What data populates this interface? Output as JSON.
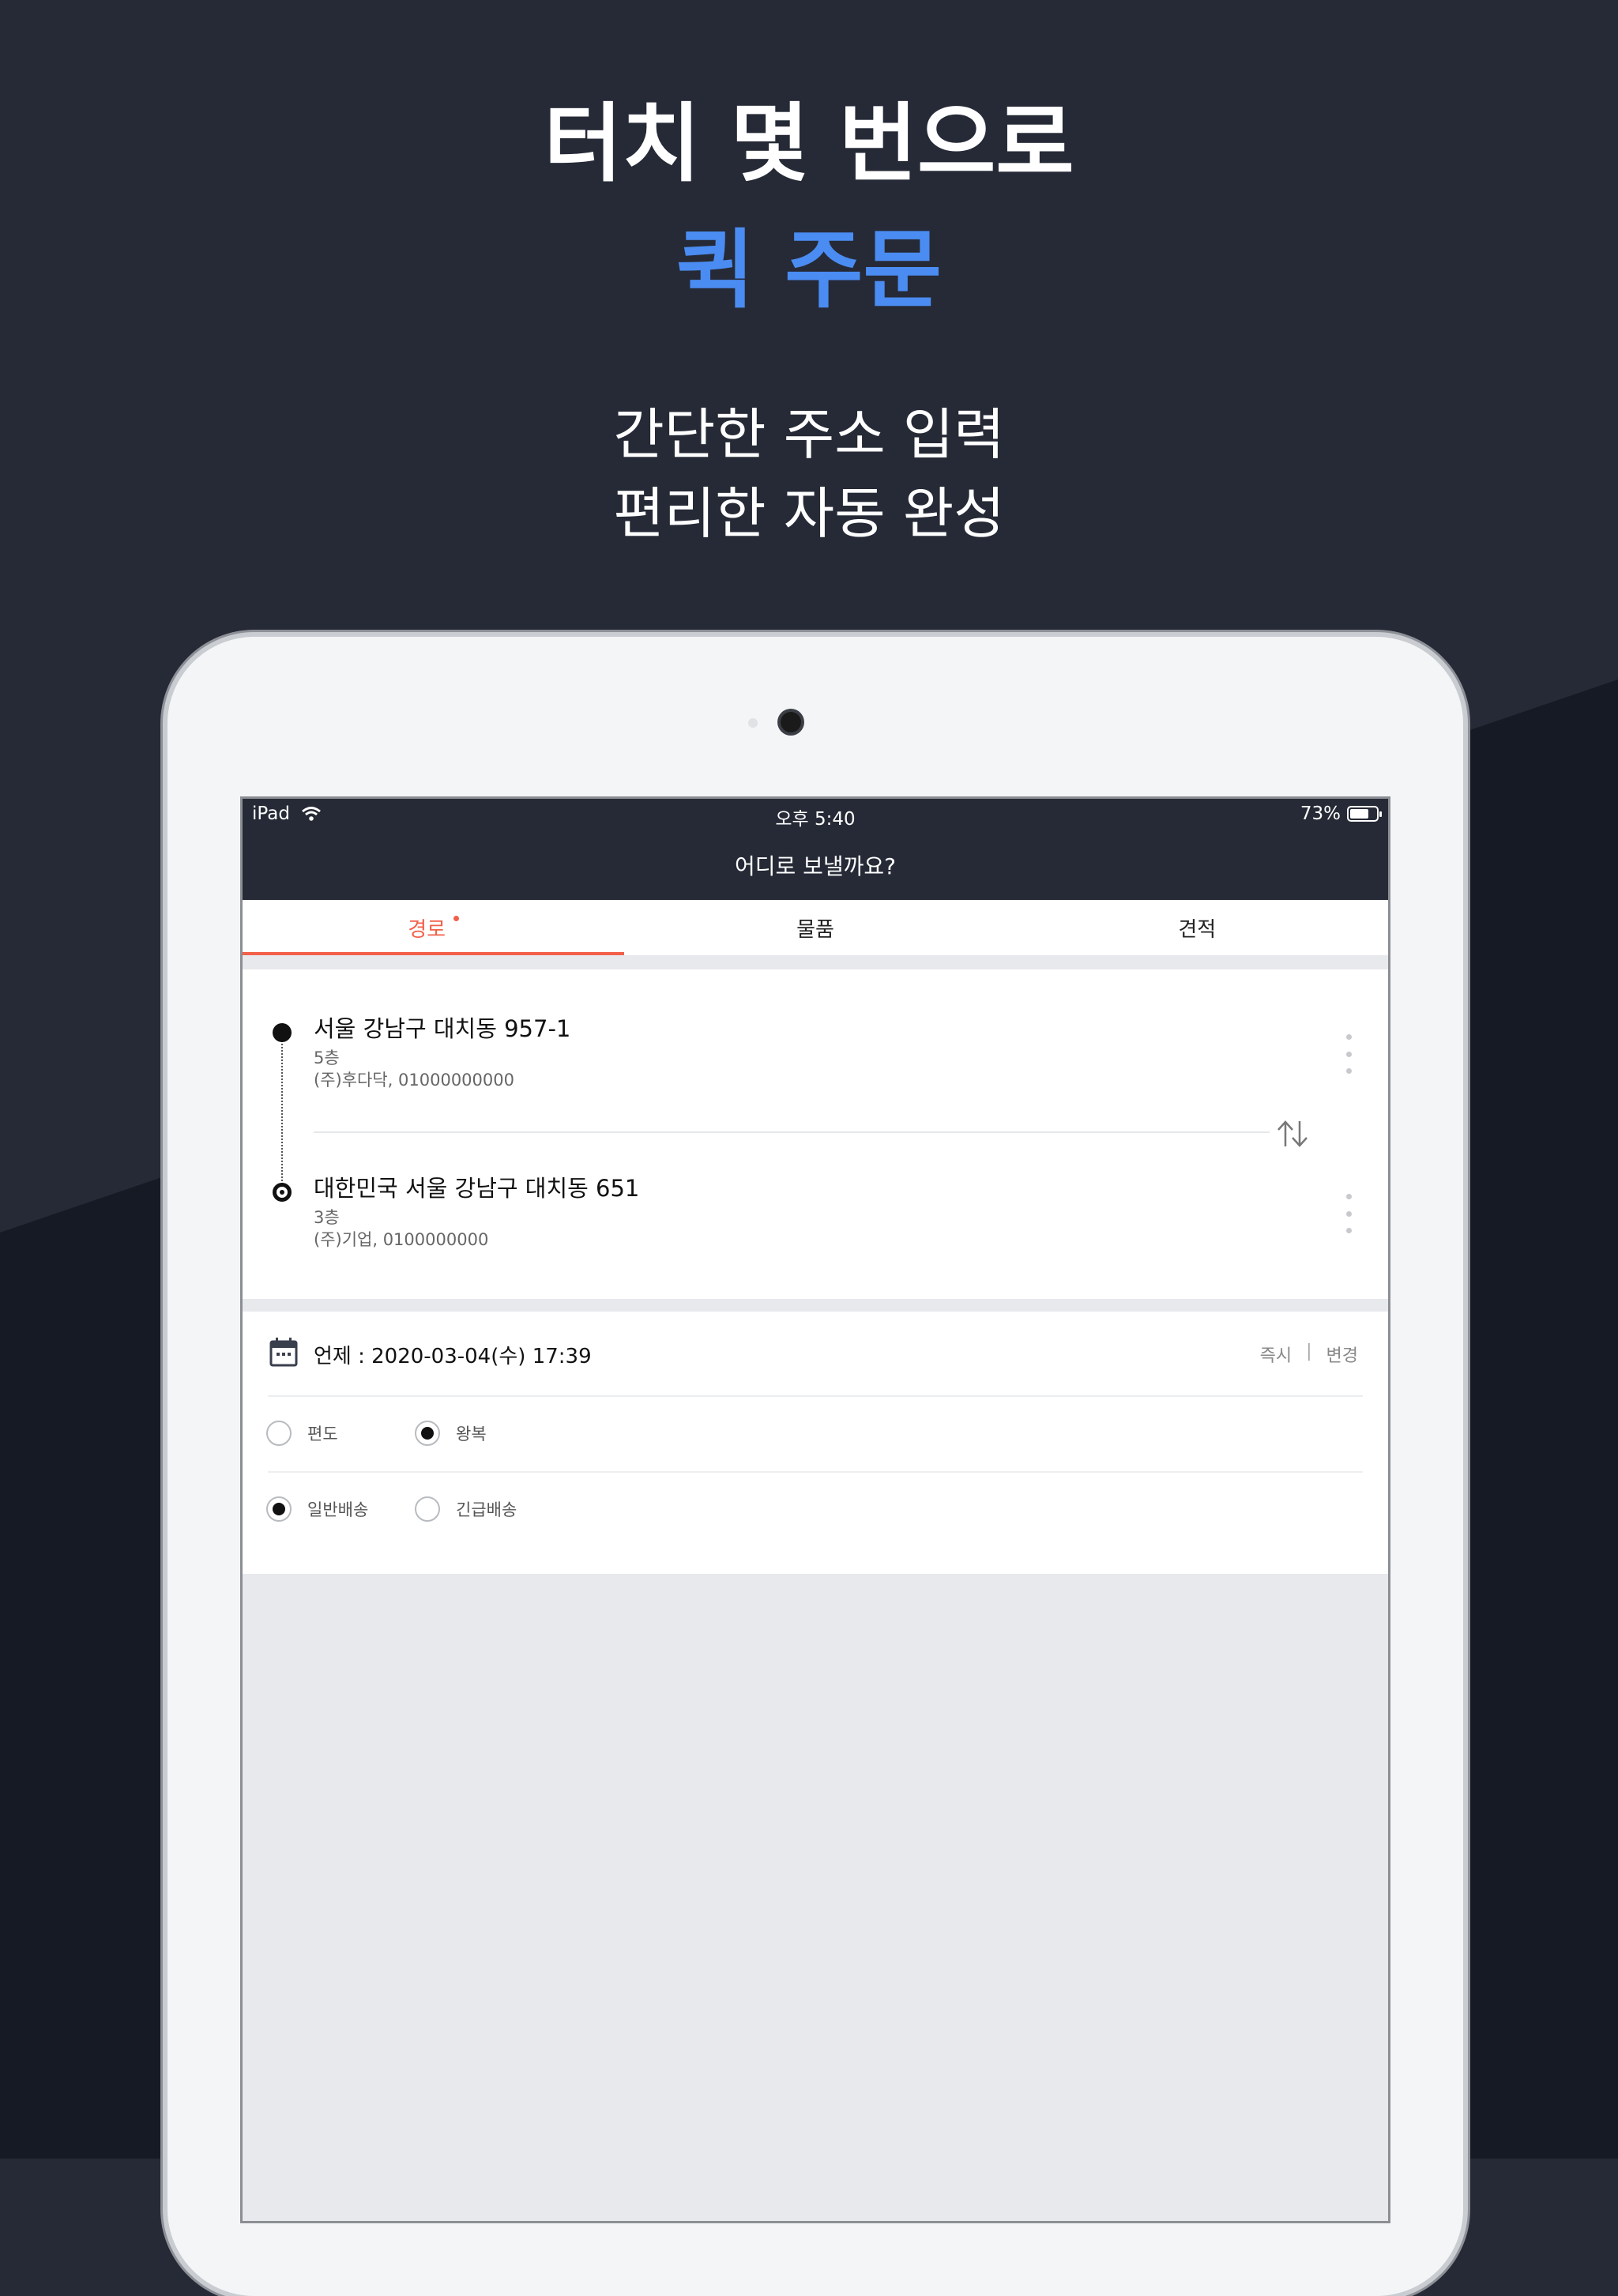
{
  "promo": {
    "headline_line1": "터치 몇 번으로",
    "headline_line2": "퀵 주문",
    "sub_line1": "간단한 주소 입력",
    "sub_line2": "편리한 자동 완성",
    "accent_color": "#4a8cf2"
  },
  "statusbar": {
    "device": "iPad",
    "time": "오후 5:40",
    "battery": "73%",
    "battery_level": 0.73
  },
  "navbar": {
    "title": "어디로 보낼까요?"
  },
  "tabs": [
    {
      "label": "경로",
      "active": true
    },
    {
      "label": "물품",
      "active": false
    },
    {
      "label": "견적",
      "active": false
    }
  ],
  "route": {
    "origin": {
      "address": "서울 강남구 대치동 957-1",
      "floor": "5층",
      "contact": "(주)후다닥, 01000000000"
    },
    "destination": {
      "address": "대한민국 서울 강남구 대치동 651",
      "floor": "3층",
      "contact": "(주)기업, 0100000000"
    }
  },
  "schedule": {
    "when": "언제 : 2020-03-04(수) 17:39",
    "now_label": "즉시",
    "separator": "|",
    "change_label": "변경"
  },
  "trip_type": {
    "one_way": "편도",
    "round_trip": "왕복",
    "selected": "왕복"
  },
  "delivery_type": {
    "normal": "일반배송",
    "urgent": "긴급배송",
    "selected": "일반배송"
  },
  "colors": {
    "tab_active": "#f2604a",
    "header_bg": "#262a36"
  }
}
